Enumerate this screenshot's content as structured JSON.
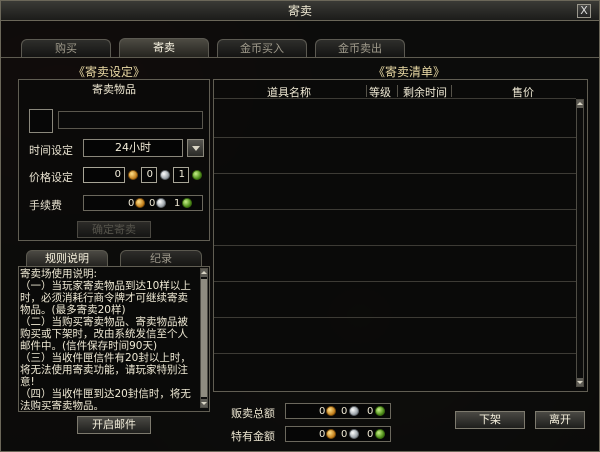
{
  "window": {
    "title": "寄卖",
    "close_label": "X"
  },
  "tabs": [
    {
      "label": "购买",
      "active": false
    },
    {
      "label": "寄卖",
      "active": true
    },
    {
      "label": "金币买入",
      "active": false
    },
    {
      "label": "金币卖出",
      "active": false
    }
  ],
  "left": {
    "section_title": "《寄卖设定》",
    "header": "寄卖物品",
    "item_name": "",
    "time_label": "时间设定",
    "time_value": "24小时",
    "price_label": "价格设定",
    "price": {
      "gold": "0",
      "silver": "0",
      "bronze": "1"
    },
    "fee_label": "手续费",
    "fee": {
      "gold": "0",
      "silver": "0",
      "bronze": "1"
    },
    "confirm_button": "确定寄卖",
    "subtabs": [
      {
        "label": "规则说明",
        "active": true
      },
      {
        "label": "纪录",
        "active": false
      }
    ],
    "rules": [
      "寄卖场使用说明:",
      "（一）当玩家寄卖物品到达10样以上时，必须消耗行商令牌才可继续寄卖物品。(最多寄卖20样)",
      "（二）当购买寄卖物品、寄卖物品被购买或下架时，改由系统发信至个人邮件中。(信件保存时间90天)",
      "（三）当收件匣信件有20封以上时，将无法使用寄卖功能，请玩家特别注意!",
      "（四）当收件匣到达20封信时，将无法购买寄卖物品。"
    ],
    "mail_button": "开启邮件"
  },
  "right": {
    "section_title": "《寄卖清单》",
    "columns": [
      "道具名称",
      "等级",
      "剩余时间",
      "售价"
    ],
    "rows": [],
    "total_label": "贩卖总额",
    "total": {
      "gold": "0",
      "silver": "0",
      "bronze": "0"
    },
    "owned_label": "特有金额",
    "owned": {
      "gold": "0",
      "silver": "0",
      "bronze": "0"
    },
    "remove_button": "下架",
    "leave_button": "离开"
  },
  "colors": {
    "accent_title": "#e9d9a4",
    "border": "#615e53",
    "background": "#0c0b0a"
  },
  "icons": [
    "close-icon",
    "gold-coin-icon",
    "silver-coin-icon",
    "bronze-coin-icon",
    "dropdown-arrow-icon",
    "scroll-up-icon",
    "scroll-down-icon"
  ]
}
